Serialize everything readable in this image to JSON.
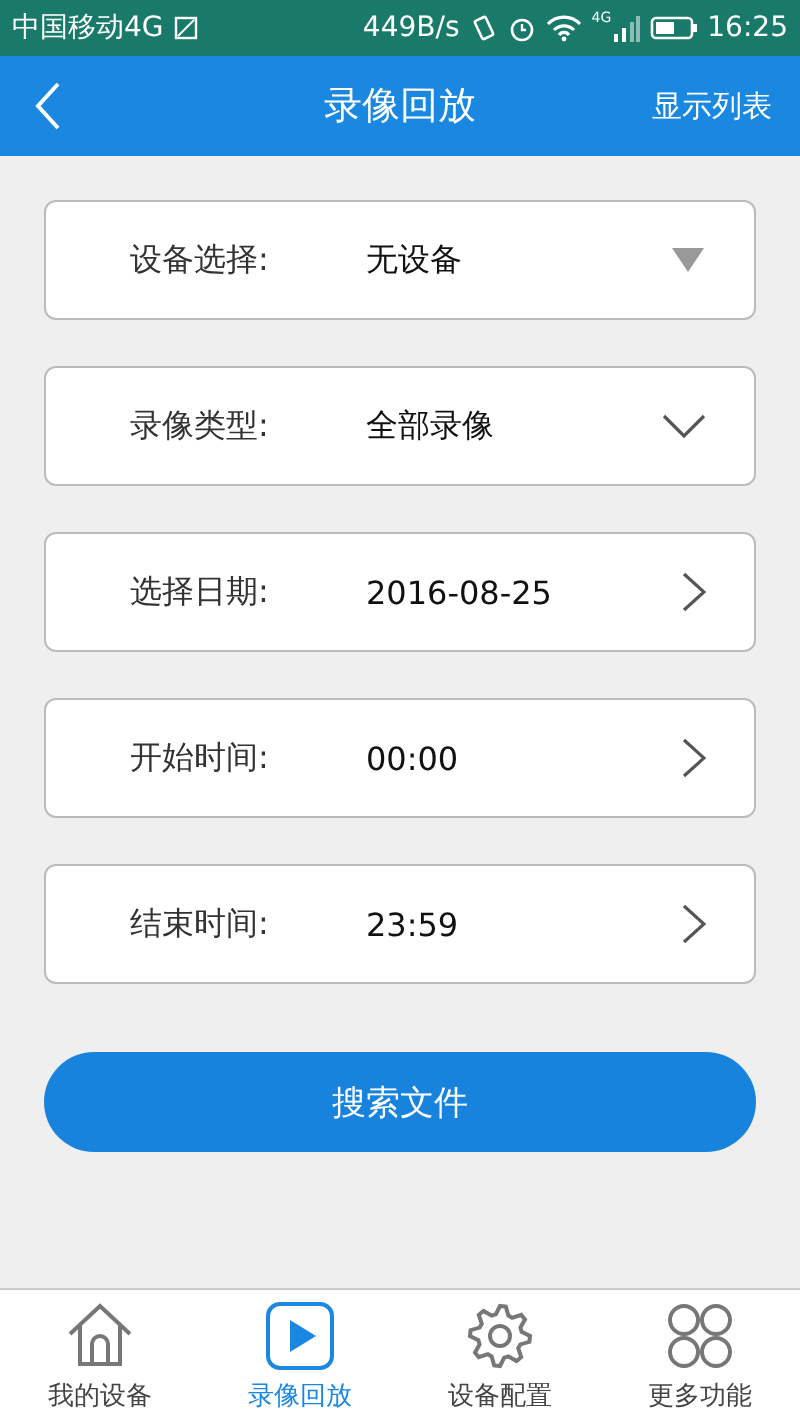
{
  "status_bar": {
    "carrier": "中国移动4G",
    "speed": "449B/s",
    "network": "4G",
    "time": "16:25"
  },
  "header": {
    "title": "录像回放",
    "action": "显示列表"
  },
  "fields": [
    {
      "label": "设备选择:",
      "value": "无设备",
      "kind": "triangle"
    },
    {
      "label": "录像类型:",
      "value": "全部录像",
      "kind": "dropdown"
    },
    {
      "label": "选择日期:",
      "value": "2016-08-25",
      "kind": "picker"
    },
    {
      "label": "开始时间:",
      "value": "00:00",
      "kind": "picker"
    },
    {
      "label": "结束时间:",
      "value": "23:59",
      "kind": "picker"
    }
  ],
  "search_button": "搜索文件",
  "tabs": [
    {
      "label": "我的设备",
      "kind": "home",
      "selected": false
    },
    {
      "label": "录像回放",
      "kind": "play",
      "selected": true
    },
    {
      "label": "设备配置",
      "kind": "gear",
      "selected": false
    },
    {
      "label": "更多功能",
      "kind": "circles",
      "selected": false
    }
  ]
}
